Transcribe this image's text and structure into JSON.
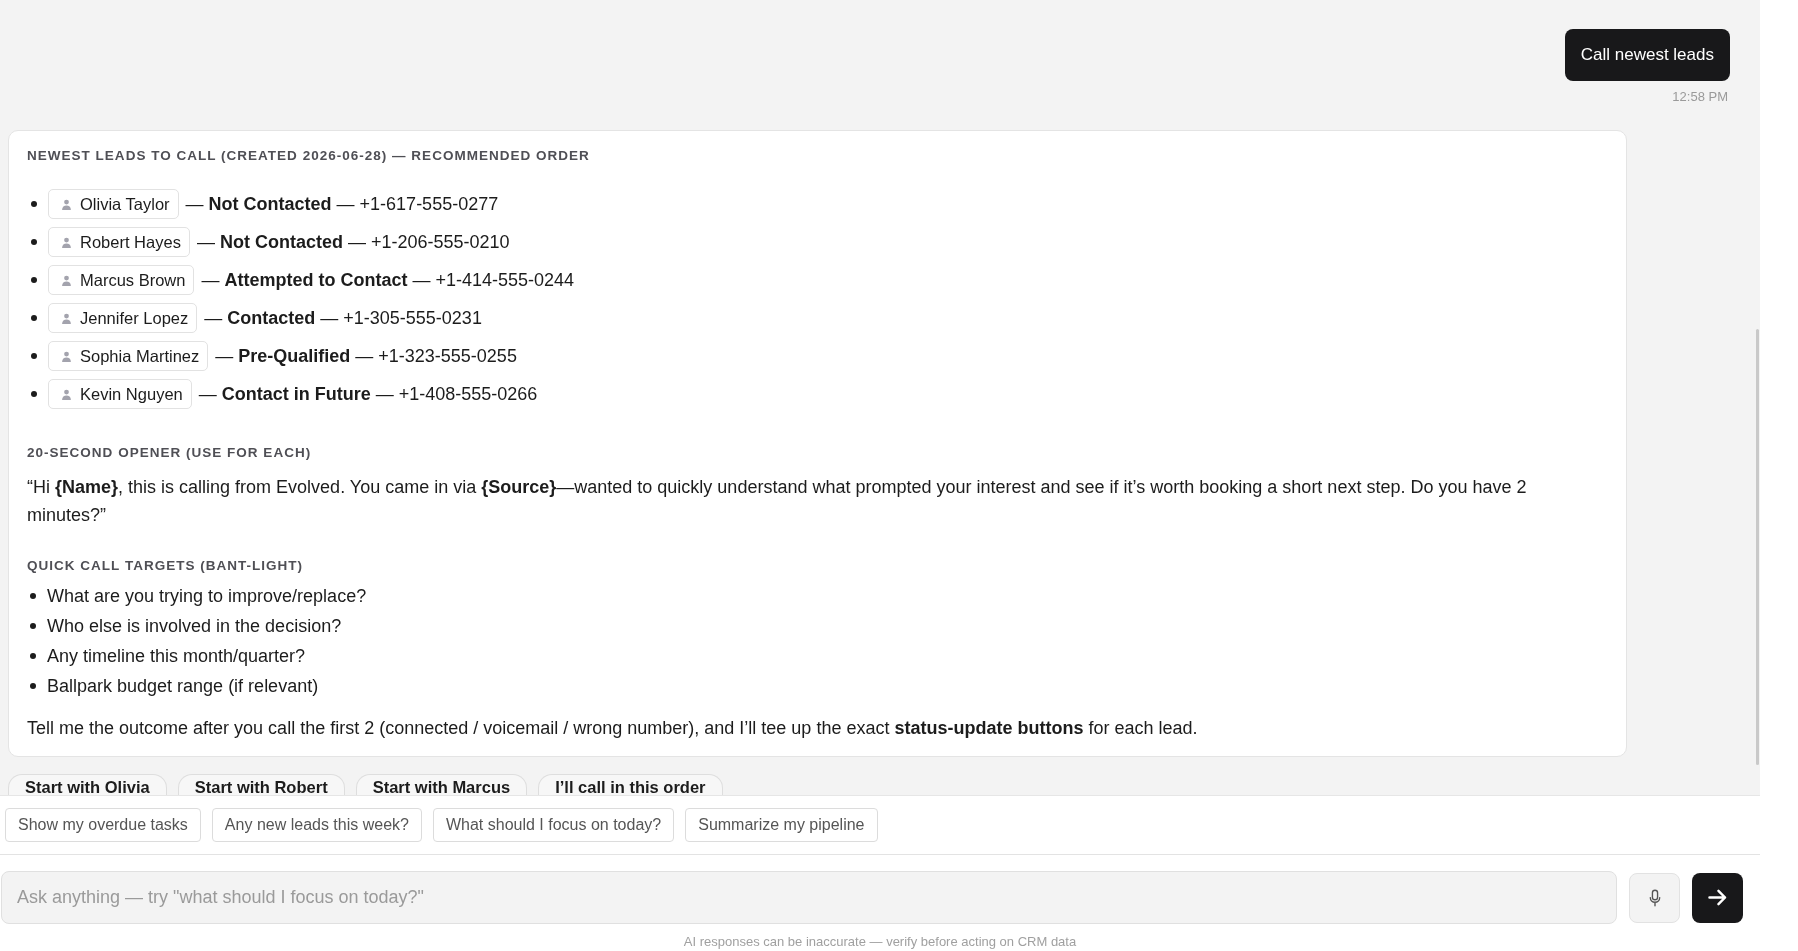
{
  "conversation": {
    "user_message": {
      "text": "Call newest leads",
      "time": "12:58 PM"
    },
    "response": {
      "leads_heading": "NEWEST LEADS TO CALL (CREATED 2026-06-28) — RECOMMENDED ORDER",
      "leads": [
        {
          "name": "Olivia Taylor",
          "detail": "— **Not Contacted** — +1-617-555-0277"
        },
        {
          "name": "Robert Hayes",
          "detail": "— **Not Contacted** — +1-206-555-0210"
        },
        {
          "name": "Marcus Brown",
          "detail": "— **Attempted to Contact** — +1-414-555-0244"
        },
        {
          "name": "Jennifer Lopez",
          "detail": "— **Contacted** — +1-305-555-0231"
        },
        {
          "name": "Sophia Martinez",
          "detail": "— **Pre-Qualified** — +1-323-555-0255"
        },
        {
          "name": "Kevin Nguyen",
          "detail": "— **Contact in Future** — +1-408-555-0266"
        }
      ],
      "opener_heading": "20-SECOND OPENER (USE FOR EACH)",
      "opener": "“Hi **{Name}**, this is calling from Evolved. You came in via **{Source}**—wanted to quickly understand what prompted your interest and see if it’s worth booking a short next step. Do you have 2 minutes?”",
      "targets_heading": "QUICK CALL TARGETS (BANT-LIGHT)",
      "targets": [
        "What are you trying to improve/replace?",
        "Who else is involved in the decision?",
        "Any timeline this month/quarter?",
        "Ballpark budget range (if relevant)"
      ],
      "closing": "Tell me the outcome after you call the first 2 (connected / voicemail / wrong number), and I’ll tee up the exact **status-update buttons** for each lead."
    },
    "quick_replies": [
      "Start with Olivia",
      "Start with Robert",
      "Start with Marcus",
      "I’ll call in this order"
    ]
  },
  "suggestions": [
    "Show my overdue tasks",
    "Any new leads this week?",
    "What should I focus on today?",
    "Summarize my pipeline"
  ],
  "composer": {
    "placeholder": "Ask anything — try \"what should I focus on today?\""
  },
  "disclaimer": "AI responses can be inaccurate — verify before acting on CRM data"
}
